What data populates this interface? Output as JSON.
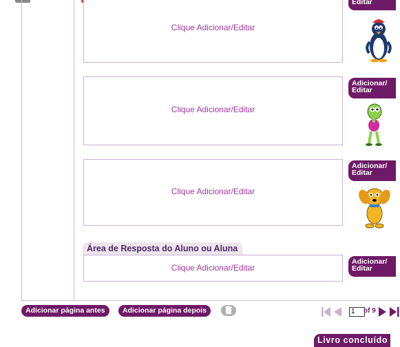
{
  "editor": {
    "boxes": [
      {
        "placeholder": "Clique Adicionar/Editar",
        "button": "Adicionar/ Editar",
        "character": "penguin-icon"
      },
      {
        "placeholder": "Clique Adicionar/Editar",
        "button": "Adicionar/ Editar",
        "character": "alien-icon"
      },
      {
        "placeholder": "Clique Adicionar/Editar",
        "button": "Adicionar/ Editar",
        "character": "dog-icon"
      }
    ],
    "answer": {
      "title": "Área de Resposta do Aluno ou Aluna",
      "placeholder": "Clique Adicionar/Editar",
      "button": "Adicionar/ Editar"
    }
  },
  "footer": {
    "add_before": "Adicionar página antes",
    "add_after": "Adicionar página depois",
    "page_current": "1",
    "page_of": "of 9",
    "done": "Livro concluído"
  },
  "colors": {
    "accent": "#6e1a66",
    "text_purple": "#a0399a",
    "border": "#c6b4d6"
  }
}
